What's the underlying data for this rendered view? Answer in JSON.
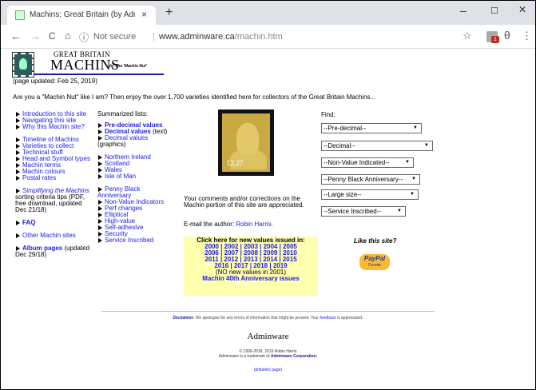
{
  "browser": {
    "tab_title": "Machins: Great Britain (by Admin",
    "tab_close": "×",
    "new_tab": "+",
    "minimize": "–",
    "maximize": "☐",
    "close": "✕",
    "back": "←",
    "forward": "→",
    "reload": "C",
    "home": "⌂",
    "info": "ⓘ",
    "security": "Not secure",
    "separator": "|",
    "url_host": "www.adminware.ca",
    "url_path": "/machin.htm",
    "star": "☆",
    "ext_badge": "1",
    "account": "θ",
    "menu": "⋮"
  },
  "header": {
    "great_britain": "GREAT BRITAIN",
    "machins": "MACHINS",
    "byline": "by The 'Machin Nut'",
    "updated": "(page updated: Feb 25, 2019)",
    "intro": "Are you a \"Machin Nut\" like I am? Then enjoy the over 1,700 varieties identified here for collectors of the Great Britain Machins..."
  },
  "left_links": {
    "intro": "Introduction to this site",
    "navigating": "Navigating this site",
    "why": "Why this Machin site?",
    "timeline": "Timeline of Machins",
    "varieties": "Varieties to collect",
    "technical": "Technical stuff",
    "head_symbol": "Head and Symbol types",
    "terms": "Machin terms",
    "colours": "Machin colours",
    "postal": "Postal rates",
    "simplifying": "Simplifying the Machins",
    "simplifying_rest1": "sorting criteria tips (PDF,",
    "simplifying_rest2": "free download, updated",
    "simplifying_rest3": "Dec 21/18)",
    "faq": "FAQ",
    "other": "Other Machin sites",
    "album": "Album pages",
    "album_rest": "(updated",
    "album_rest2": "Dec 29/18)"
  },
  "summarized": {
    "heading": "Summarized lists:",
    "predecimal": "Pre-decimal values",
    "decimal": "Decimal values",
    "decimal_text": "(text)",
    "decimal2": "Decimal values",
    "graphics": "(graphics)",
    "ni": "Northern Ireland",
    "scotland": "Scotland",
    "wales": "Wales",
    "iom": "Isle of Man",
    "pb": "Penny Black",
    "anniv": "Anniversary",
    "nvi": "Non-Value Indicators",
    "perf": "Perf changes",
    "elliptical": "Elliptical",
    "high": "High-value",
    "self": "Self-adhesive",
    "security": "Security",
    "service": "Service Inscribed"
  },
  "stamp": {
    "value": "£2.27"
  },
  "comments": {
    "text": "Your comments and/or corrections on the Machin portion of this site are appreciated.",
    "email_label": "E-mail the author:",
    "email_name": "Robin Harris."
  },
  "new_values": {
    "heading1": "Click here for new values issued in:",
    "row1": "2000 | 2002 | 2003 | 2004 | 2005",
    "row2": "2006 | 2007 | 2008 | 2009 | 2010",
    "row3": "2011 | 2012 | 2013 | 2014 | 2015",
    "row4": "2016 | 2017 | 2018 | 2019",
    "note": "(NO new values in 2001)",
    "anniv": "Machin 40th Anniversary issues"
  },
  "find": {
    "label": "Find:",
    "selects": [
      "--Pre-decimal--",
      "--Decimal--",
      "--Non-Value Indicated--",
      "--Penny Black Anniversary--",
      "--Large size--",
      "--Service Inscribed--"
    ],
    "arrow": "▼"
  },
  "like": {
    "text": "Like this site?",
    "paypal": "PayPal",
    "donate": "Donate"
  },
  "footer": {
    "disclaimer_label": "Disclaimer:",
    "disclaimer_text": "We apologize for any errors of information that might be present. Your",
    "feedback": "feedback",
    "disclaimer_end": "is appreciated.",
    "logo": "Adminware",
    "copyright": "© 1999-2018, 2019 Robin Harris",
    "trademark": "Adminware is a trademark of",
    "corp": "Adminware Corporation.",
    "philatelic": "(philatelic page)"
  }
}
